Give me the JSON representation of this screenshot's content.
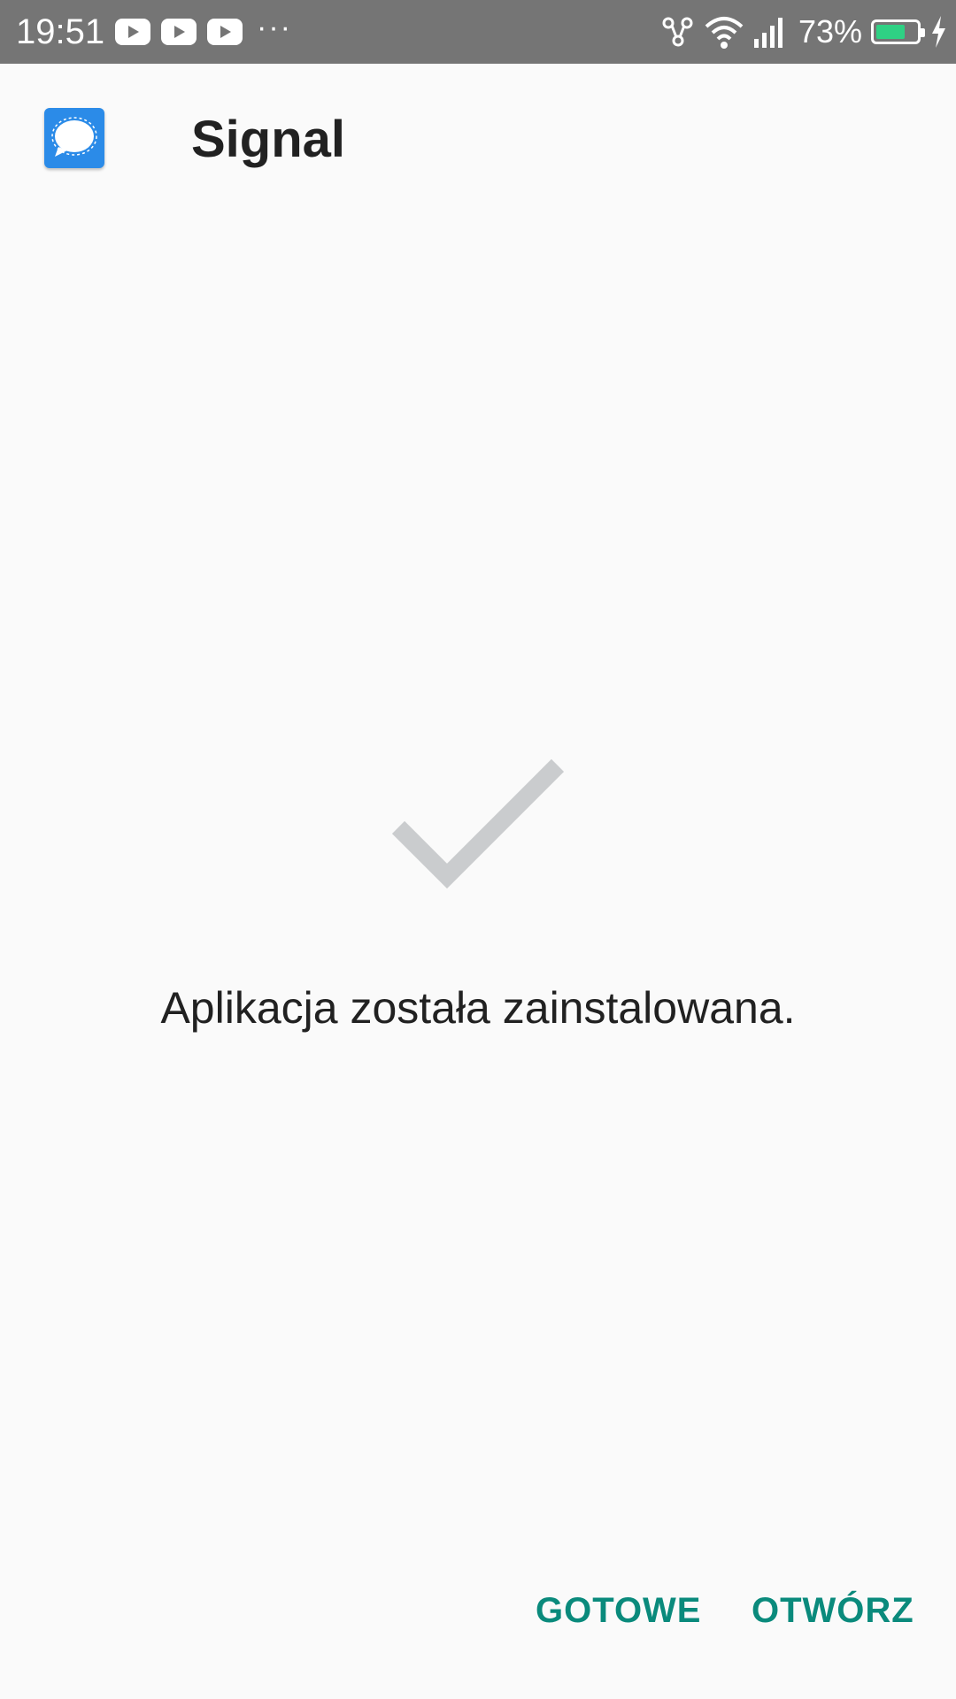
{
  "status_bar": {
    "time": "19:51",
    "notification_icons": [
      "youtube-icon",
      "youtube-icon",
      "youtube-icon"
    ],
    "more_indicator": "···",
    "battery_percent": "73%",
    "battery_level": 0.73,
    "battery_color": "#2fd184",
    "background": "#757575"
  },
  "header": {
    "app_name": "Signal",
    "app_icon": "signal-app-icon",
    "icon_color": "#2b8be8"
  },
  "main": {
    "status_icon": "checkmark-icon",
    "message": "Aplikacja została zainstalowana."
  },
  "actions": {
    "done_label": "GOTOWE",
    "open_label": "OTWÓRZ",
    "accent_color": "#0a8a7c"
  }
}
